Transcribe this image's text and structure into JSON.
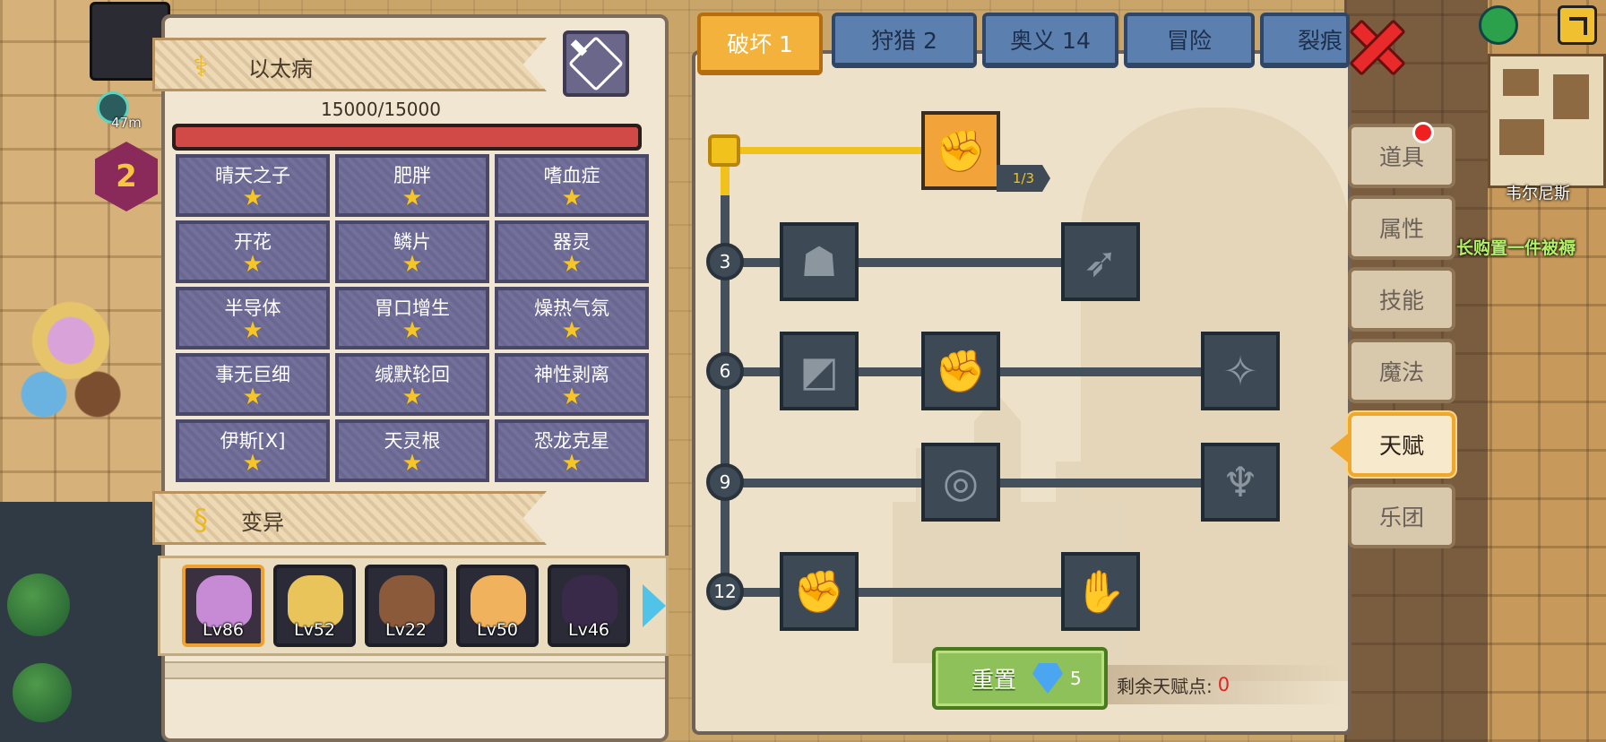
{
  "hud": {
    "distance": "47m",
    "level_badge": "2",
    "city_name": "韦尔尼斯",
    "scroll_message": "长购置一件被褥"
  },
  "disease": {
    "title": "以太病",
    "hp_text": "15000/15000",
    "hp_fraction": 1.0,
    "traits": [
      {
        "name": "晴天之子",
        "stars": 1
      },
      {
        "name": "肥胖",
        "stars": 1
      },
      {
        "name": "嗜血症",
        "stars": 1
      },
      {
        "name": "开花",
        "stars": 1
      },
      {
        "name": "鳞片",
        "stars": 1
      },
      {
        "name": "器灵",
        "stars": 1
      },
      {
        "name": "半导体",
        "stars": 1
      },
      {
        "name": "胃口增生",
        "stars": 1
      },
      {
        "name": "燥热气氛",
        "stars": 1
      },
      {
        "name": "事无巨细",
        "stars": 1
      },
      {
        "name": "缄默轮回",
        "stars": 1
      },
      {
        "name": "神性剥离",
        "stars": 1
      },
      {
        "name": "伊斯[X]",
        "stars": 1
      },
      {
        "name": "天灵根",
        "stars": 1
      },
      {
        "name": "恐龙克星",
        "stars": 1
      }
    ],
    "star_glyph": "★"
  },
  "mutation": {
    "title": "变异"
  },
  "characters": [
    {
      "level": "Lv86",
      "color": "#c78bd6"
    },
    {
      "level": "Lv52",
      "color": "#e8c45a"
    },
    {
      "level": "Lv22",
      "color": "#8a5a3a"
    },
    {
      "level": "Lv50",
      "color": "#f0b25c"
    },
    {
      "level": "Lv46",
      "color": "#3a2a4a"
    }
  ],
  "tabs": [
    {
      "label": "破坏 1",
      "active": true
    },
    {
      "label": "狩猎 2",
      "active": false
    },
    {
      "label": "奥义 14",
      "active": false
    },
    {
      "label": "冒险",
      "active": false
    },
    {
      "label": "裂痕",
      "active": false
    }
  ],
  "talent_tree": {
    "root_skill": {
      "icon": "arm-wrestle-icon",
      "progress": "1/3"
    },
    "tiers": [
      {
        "level": "3",
        "skills": [
          "muscle-body-icon",
          "arrow-strike-icon"
        ]
      },
      {
        "level": "6",
        "skills": [
          "shatter-icon",
          "punch-icon",
          "splash-hit-icon"
        ]
      },
      {
        "level": "9",
        "skills": [
          "shockwave-icon",
          "bat-wings-icon"
        ]
      },
      {
        "level": "12",
        "skills": [
          "fist-icon",
          "clenched-hand-icon"
        ]
      }
    ]
  },
  "reset": {
    "label": "重置",
    "cost": "5"
  },
  "remaining_points": {
    "label": "剩余天赋点:",
    "value": "0"
  },
  "side_menu": [
    {
      "label": "道具",
      "active": false,
      "badge": true
    },
    {
      "label": "属性",
      "active": false,
      "badge": false
    },
    {
      "label": "技能",
      "active": false,
      "badge": false
    },
    {
      "label": "魔法",
      "active": false,
      "badge": false
    },
    {
      "label": "天赋",
      "active": true,
      "badge": false
    },
    {
      "label": "乐团",
      "active": false,
      "badge": false
    }
  ],
  "colors": {
    "accent_gold": "#f2c21c",
    "hp_red": "#d24a48",
    "trait_purple": "#6a6893",
    "tab_blue": "#5b7fae",
    "tab_active": "#f3b23b",
    "reset_green": "#8fc15a",
    "remain_red": "#e02424"
  }
}
